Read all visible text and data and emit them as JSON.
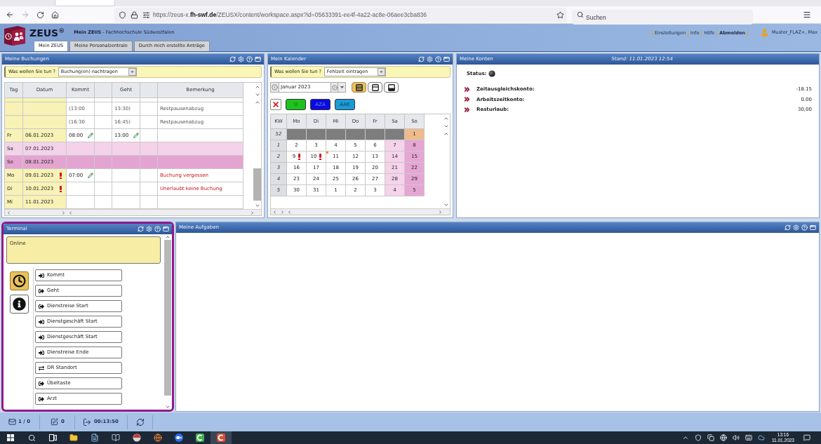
{
  "browser": {
    "url": "https://zeus-x.**fh-swf.de**/ZEUSX/content/workspace.aspx?id=05633391-ee4f-4a22-ac8e-06aee3cba836",
    "search": {
      "placeholder": "Suchen"
    }
  },
  "header": {
    "logo": "ZEUS$^{®}$",
    "title": "**Mein ZEUS** - Fachhochschule Südwestfalen",
    "tabs": [
      {
        "label": "Mein ZEUS",
        "selected": true
      },
      {
        "label": "Meine Personalzentrale",
        "selected": false
      },
      {
        "label": "Durch mich erstellte Anträge",
        "selected": false
      }
    ],
    "links": [
      {
        "label": "Einstellungen",
        "bold": false
      },
      {
        "label": "Info",
        "bold": false
      },
      {
        "label": "Hilfe",
        "bold": false
      },
      {
        "label": "Abmelden",
        "bold": true
      }
    ],
    "user": "Muster_FLAZ+, Max"
  },
  "bookings": {
    "title": "Meine Buchungen",
    "action_label": "Was wollen Sie tun ?",
    "action": "Buchung(en) nachtragen",
    "columns": [
      "Tag",
      "Datum",
      "Kommt",
      "Geht",
      "Bemerkung"
    ],
    "rows": [
      {
        "kind": "detail",
        "warning": false,
        "kommt": "(13:00",
        "kommt_edited": false,
        "geht": "13:30)",
        "geht_edited": false,
        "note": "Restpausenabzug"
      },
      {
        "kind": "detail",
        "warning": false,
        "kommt": "(16:30",
        "kommt_edited": false,
        "geht": "16:45)",
        "geht_edited": false,
        "note": "Restpausenabzug"
      },
      {
        "kind": "weekday",
        "tag": "Fr",
        "datum": "06.01.2023",
        "warning": false,
        "kommt": "08:00",
        "kommt_edited": true,
        "geht": "13:00",
        "geht_edited": true
      },
      {
        "kind": "saturday",
        "tag": "Sa",
        "datum": "07.01.2023",
        "warning": false,
        "kommt_edited": false,
        "geht_edited": false
      },
      {
        "kind": "sunday",
        "tag": "So",
        "datum": "08.01.2023",
        "warning": false,
        "kommt_edited": false,
        "geht_edited": false
      },
      {
        "kind": "weekday",
        "tag": "Mo",
        "datum": "09.01.2023",
        "warning": true,
        "kommt": "07:00",
        "kommt_edited": true,
        "geht_edited": false,
        "note": "Buchung vergessen"
      },
      {
        "kind": "weekday",
        "tag": "Di",
        "datum": "10.01.2023",
        "warning": true,
        "kommt_edited": false,
        "geht_edited": false,
        "note": "Unerlaubt keine Buchung"
      },
      {
        "kind": "weekday",
        "tag": "Mi",
        "datum": "11.01.2023",
        "warning": false,
        "kommt_edited": false,
        "geht_edited": false
      }
    ]
  },
  "calendar": {
    "title": "Mein Kalender",
    "action_label": "Was wollen Sie tun ?",
    "action": "Fehlzeit eintragen",
    "month": "Januar 2023",
    "views": [
      {
        "kind": "split",
        "selected": true
      },
      {
        "kind": "top",
        "selected": false
      },
      {
        "kind": "bottom",
        "selected": false
      }
    ],
    "absence_types": [
      {
        "label": "U",
        "color": "#1ec21e"
      },
      {
        "label": "AZA",
        "color": "#0b0be0"
      },
      {
        "label": "AAK",
        "color": "#1c9ad6"
      }
    ],
    "columns": [
      "KW",
      "Mo",
      "Di",
      "Mi",
      "Do",
      "Fr",
      "Sa",
      "So"
    ],
    "weeks": [
      {
        "week": "52",
        "days": [
          {
            "kind": "outside",
            "warning": false,
            "marker": false
          },
          {
            "kind": "outside",
            "warning": false,
            "marker": false
          },
          {
            "kind": "outside",
            "warning": false,
            "marker": false
          },
          {
            "kind": "outside",
            "warning": false,
            "marker": false
          },
          {
            "kind": "outside",
            "warning": false,
            "marker": false
          },
          {
            "kind": "outside",
            "warning": false,
            "marker": false
          },
          {
            "day": "1",
            "kind": "holiday",
            "warning": false,
            "marker": false
          }
        ]
      },
      {
        "week": "1",
        "days": [
          {
            "day": "2",
            "kind": "weekday",
            "warning": false,
            "marker": false
          },
          {
            "day": "3",
            "kind": "weekday",
            "warning": false,
            "marker": false
          },
          {
            "day": "4",
            "kind": "weekday",
            "warning": false,
            "marker": false
          },
          {
            "day": "5",
            "kind": "weekday",
            "warning": false,
            "marker": false
          },
          {
            "day": "6",
            "kind": "weekday",
            "warning": false,
            "marker": false
          },
          {
            "day": "7",
            "kind": "saturday",
            "warning": false,
            "marker": false
          },
          {
            "day": "8",
            "kind": "sunday",
            "warning": false,
            "marker": false
          }
        ]
      },
      {
        "week": "2",
        "days": [
          {
            "day": "9",
            "kind": "weekday",
            "warning": true,
            "marker": false
          },
          {
            "day": "10",
            "kind": "weekday",
            "warning": true,
            "marker": false
          },
          {
            "day": "11",
            "kind": "weekday",
            "warning": false,
            "marker": true
          },
          {
            "day": "12",
            "kind": "weekday",
            "warning": false,
            "marker": false
          },
          {
            "day": "13",
            "kind": "weekday",
            "warning": false,
            "marker": false
          },
          {
            "day": "14",
            "kind": "saturday",
            "warning": false,
            "marker": false
          },
          {
            "day": "15",
            "kind": "sunday",
            "warning": false,
            "marker": false
          }
        ]
      },
      {
        "week": "3",
        "days": [
          {
            "day": "16",
            "kind": "weekday",
            "warning": false,
            "marker": false
          },
          {
            "day": "17",
            "kind": "weekday",
            "warning": false,
            "marker": false
          },
          {
            "day": "18",
            "kind": "weekday",
            "warning": false,
            "marker": false
          },
          {
            "day": "19",
            "kind": "weekday",
            "warning": false,
            "marker": false
          },
          {
            "day": "20",
            "kind": "weekday",
            "warning": false,
            "marker": false
          },
          {
            "day": "21",
            "kind": "saturday",
            "warning": false,
            "marker": false
          },
          {
            "day": "22",
            "kind": "sunday",
            "warning": false,
            "marker": false
          }
        ]
      },
      {
        "week": "4",
        "days": [
          {
            "day": "23",
            "kind": "weekday",
            "warning": false,
            "marker": false
          },
          {
            "day": "24",
            "kind": "weekday",
            "warning": false,
            "marker": false
          },
          {
            "day": "25",
            "kind": "weekday",
            "warning": false,
            "marker": false
          },
          {
            "day": "26",
            "kind": "weekday",
            "warning": false,
            "marker": false
          },
          {
            "day": "27",
            "kind": "weekday",
            "warning": false,
            "marker": false
          },
          {
            "day": "28",
            "kind": "saturday",
            "warning": false,
            "marker": false
          },
          {
            "day": "29",
            "kind": "sunday",
            "warning": false,
            "marker": false
          }
        ]
      },
      {
        "week": "5",
        "days": [
          {
            "day": "30",
            "kind": "weekday",
            "warning": false,
            "marker": false
          },
          {
            "day": "31",
            "kind": "weekday",
            "warning": false,
            "marker": false
          },
          {
            "day": "1",
            "kind": "weekday",
            "warning": false,
            "marker": false
          },
          {
            "day": "2",
            "kind": "weekday",
            "warning": false,
            "marker": false
          },
          {
            "day": "3",
            "kind": "weekday",
            "warning": false,
            "marker": false
          },
          {
            "day": "4",
            "kind": "saturday",
            "warning": false,
            "marker": false
          },
          {
            "day": "5",
            "kind": "sunday",
            "warning": false,
            "marker": false
          }
        ]
      }
    ]
  },
  "accounts": {
    "title": "Meine Konten",
    "stand": "Stand: 11.01.2023 12:54",
    "status_label": "Status:",
    "items": [
      {
        "label": "Zeitausgleichskonto:",
        "value": "-18.15"
      },
      {
        "label": "Arbeitszeitkonto:",
        "value": "0.00"
      },
      {
        "label": "Resturlaub:",
        "value": "30,00"
      }
    ]
  },
  "terminal": {
    "title": "Terminal",
    "message": "Online",
    "modes": [
      {
        "kind": "clock",
        "selected": true
      },
      {
        "kind": "info",
        "selected": false
      }
    ],
    "actions": [
      {
        "label": "Kommt",
        "kind": "in"
      },
      {
        "label": "Geht",
        "kind": "out"
      },
      {
        "label": "Dienstreise Start",
        "kind": "out"
      },
      {
        "label": "Dienstgeschäft Start",
        "kind": "in"
      },
      {
        "label": "Dienstgeschäft Start",
        "kind": "in"
      },
      {
        "label": "Dienstreise Ende",
        "kind": "in"
      },
      {
        "label": "DR Standort",
        "kind": "switch"
      },
      {
        "label": "Übeltaste",
        "kind": "out"
      },
      {
        "label": "Arzt",
        "kind": "out"
      }
    ]
  },
  "tasks": {
    "title": "Meine Aufgaben"
  },
  "status_bar": {
    "messages": "1 / 0",
    "drafts": "0",
    "session": "00:13:50"
  },
  "taskbar": {
    "time": "13:16",
    "date": "11.01.2023"
  }
}
